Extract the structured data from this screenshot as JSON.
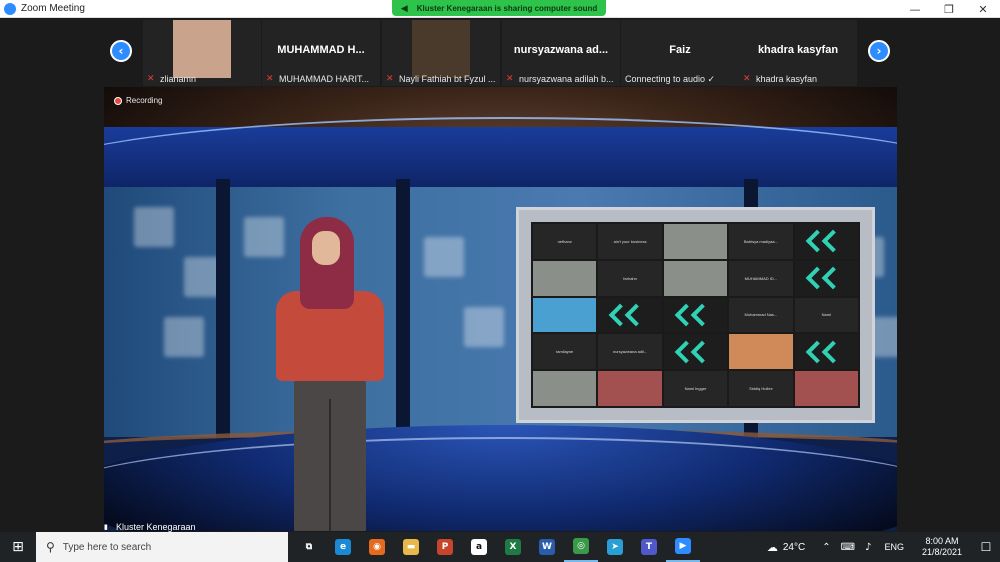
{
  "window": {
    "title": "Zoom Meeting",
    "minimize": "—",
    "restore": "❐",
    "close": "✕"
  },
  "banner": {
    "text": "Kluster Kenegaraan is sharing computer sound",
    "icon": "speaker-icon"
  },
  "participants": [
    {
      "display": "",
      "label": "zlianamn",
      "muted": true,
      "video": true
    },
    {
      "display": "MUHAMMAD  H...",
      "label": "MUHAMMAD HARIT...",
      "muted": true,
      "video": false
    },
    {
      "display": "",
      "label": "Nayli Fathiah bt Fyzul ...",
      "muted": true,
      "video": true
    },
    {
      "display": "nursyazwana  ad...",
      "label": "nursyazwana adilah b...",
      "muted": true,
      "video": false
    },
    {
      "display": "Faiz",
      "label": "Connecting to audio ✓",
      "muted": false,
      "video": false
    },
    {
      "display": "khadra kasyfan",
      "label": "khadra kasyfan",
      "muted": true,
      "video": false
    }
  ],
  "nav": {
    "prev": "‹",
    "next": "›"
  },
  "recording": "Recording",
  "active_speaker": "Kluster Kenegaraan",
  "screen_grid": [
    {
      "t": "text",
      "v": "nefhanz"
    },
    {
      "t": "text",
      "v": "ain't your business"
    },
    {
      "t": "photo",
      "v": ""
    },
    {
      "t": "text",
      "v": "Batrisya madiyaa..."
    },
    {
      "t": "pattern",
      "v": ""
    },
    {
      "t": "photo",
      "v": ""
    },
    {
      "t": "text",
      "v": "farhahn"
    },
    {
      "t": "photo",
      "v": ""
    },
    {
      "t": "text",
      "v": "MUHAMMAD  ID..."
    },
    {
      "t": "pattern",
      "v": ""
    },
    {
      "t": "photo2",
      "v": ""
    },
    {
      "t": "pattern",
      "v": ""
    },
    {
      "t": "pattern",
      "v": ""
    },
    {
      "t": "text",
      "v": "Muhammad  Nas..."
    },
    {
      "t": "text",
      "v": "Nami"
    },
    {
      "t": "text",
      "v": "tamilayne"
    },
    {
      "t": "text",
      "v": "nursyazwana  adil..."
    },
    {
      "t": "pattern",
      "v": ""
    },
    {
      "t": "photo3",
      "v": ""
    },
    {
      "t": "pattern",
      "v": ""
    },
    {
      "t": "photo",
      "v": ""
    },
    {
      "t": "photo4",
      "v": ""
    },
    {
      "t": "text",
      "v": "Nami Ingger"
    },
    {
      "t": "text",
      "v": "Siddiq Hullee"
    },
    {
      "t": "photo4",
      "v": ""
    }
  ],
  "taskbar": {
    "search_placeholder": "Type here to search",
    "apps": [
      {
        "name": "task-view-icon",
        "glyph": "⧉",
        "color": "#1f2326"
      },
      {
        "name": "edge-icon",
        "glyph": "e",
        "color": "#1a8ad4"
      },
      {
        "name": "firefox-icon",
        "glyph": "◉",
        "color": "#e66a1e"
      },
      {
        "name": "file-explorer-icon",
        "glyph": "▬",
        "color": "#e8b84a"
      },
      {
        "name": "powerpoint-icon",
        "glyph": "P",
        "color": "#c8442a"
      },
      {
        "name": "amazon-icon",
        "glyph": "a",
        "color": "#ffffff"
      },
      {
        "name": "excel-icon",
        "glyph": "X",
        "color": "#1e7b45"
      },
      {
        "name": "word-icon",
        "glyph": "W",
        "color": "#2a5cad"
      },
      {
        "name": "chrome-icon",
        "glyph": "◎",
        "color": "#3b9a4a"
      },
      {
        "name": "telegram-icon",
        "glyph": "➤",
        "color": "#2a9fd6"
      },
      {
        "name": "teams-icon",
        "glyph": "T",
        "color": "#5059c9"
      },
      {
        "name": "zoom-icon",
        "glyph": "▶",
        "color": "#2d8cff"
      }
    ],
    "temperature": "24°C",
    "language": "ENG",
    "time": "8:00 AM",
    "date": "21/8/2021"
  }
}
